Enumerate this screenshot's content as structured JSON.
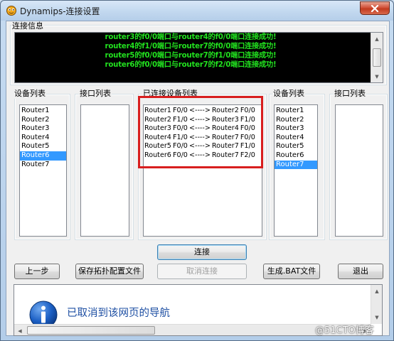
{
  "window": {
    "title": "Dynamips-连接设置"
  },
  "info_group": {
    "label": "连接信息",
    "lines": [
      "router3的f0/0端口与router4的f0/0端口连接成功!",
      "router4的f1/0端口与router7的f0/0端口连接成功!",
      "router5的f0/0端口与router7的f1/0端口连接成功!",
      "router6的f0/0端口与router7的f2/0端口连接成功!"
    ]
  },
  "left_device_list": {
    "label": "设备列表",
    "items": [
      "Router1",
      "Router2",
      "Router3",
      "Router4",
      "Router5",
      "Router6",
      "Router7"
    ],
    "selected": "Router6"
  },
  "left_port_list": {
    "label": "接口列表",
    "items": []
  },
  "connected_list": {
    "label": "已连接设备列表",
    "items": [
      "Router1 F0/0 <----> Router2 F0/0",
      "Router2 F1/0 <----> Router3 F1/0",
      "Router3 F0/0 <----> Router4 F0/0",
      "Router4 F1/0 <----> Router7 F0/0",
      "Router5 F0/0 <----> Router7 F1/0",
      "Router6 F0/0 <----> Router7 F2/0"
    ]
  },
  "right_device_list": {
    "label": "设备列表",
    "items": [
      "Router1",
      "Router2",
      "Router3",
      "Router4",
      "Router5",
      "Router6",
      "Router7"
    ],
    "selected": "Router7"
  },
  "right_port_list": {
    "label": "接口列表",
    "items": []
  },
  "buttons": {
    "connect": "连接",
    "prev": "上一步",
    "save_topology": "保存拓扑配置文件",
    "disconnect": "取消连接",
    "generate_bat": "生成.BAT文件",
    "exit": "退出"
  },
  "browser_message": "已取消到该网页的导航",
  "watermark": "@51CTO博客",
  "colors": {
    "info_text": "#22e11f",
    "selection": "#3399ff",
    "highlight_border": "#d81e1e",
    "nav_message": "#1e4fa3"
  },
  "icons": {
    "app": "dynamips-app-icon",
    "close": "close-icon",
    "info": "info-icon"
  }
}
